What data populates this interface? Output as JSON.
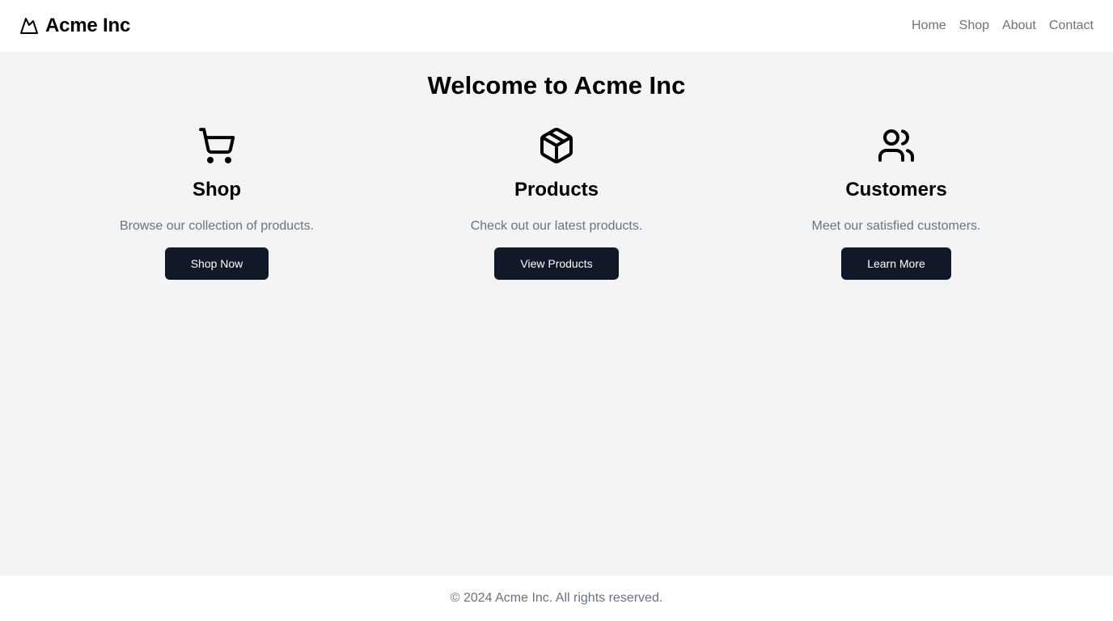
{
  "header": {
    "brand": {
      "name": "Acme Inc",
      "icon": "mountain-icon"
    },
    "nav": [
      {
        "label": "Home"
      },
      {
        "label": "Shop"
      },
      {
        "label": "About"
      },
      {
        "label": "Contact"
      }
    ]
  },
  "main": {
    "title": "Welcome to Acme Inc",
    "features": [
      {
        "icon": "shopping-cart-icon",
        "title": "Shop",
        "description": "Browse our collection of products.",
        "button": "Shop Now"
      },
      {
        "icon": "package-icon",
        "title": "Products",
        "description": "Check out our latest products.",
        "button": "View Products"
      },
      {
        "icon": "users-icon",
        "title": "Customers",
        "description": "Meet our satisfied customers.",
        "button": "Learn More"
      }
    ]
  },
  "footer": {
    "copyright": "© 2024 Acme Inc. All rights reserved."
  },
  "colors": {
    "background": "#f3f4f6",
    "surface": "#ffffff",
    "button": "#111827",
    "muted_text": "#6b7280"
  }
}
